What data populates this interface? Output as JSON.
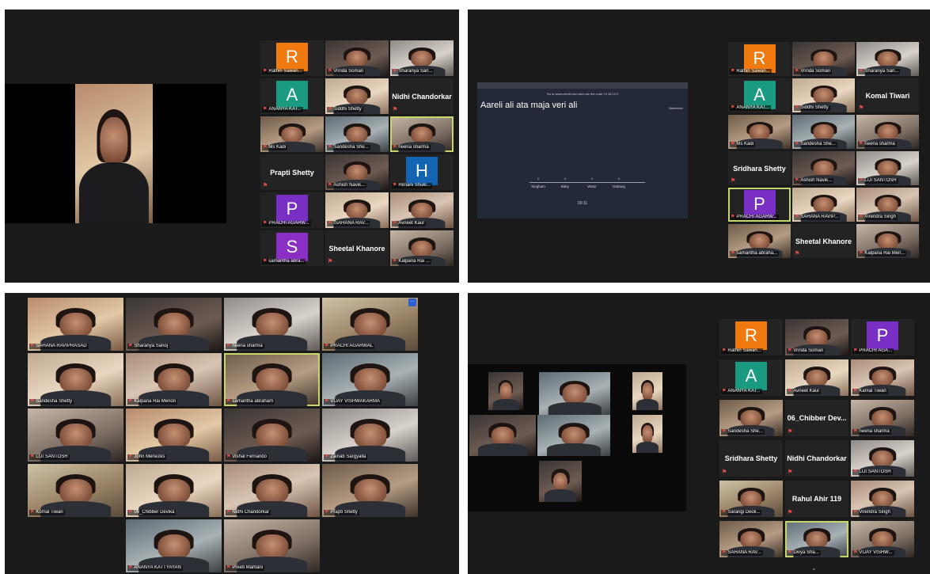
{
  "panel1": {
    "tiles": [
      {
        "label": "Rathin Sawan...",
        "avatar": "R",
        "color": "#f07a0f"
      },
      {
        "label": "Vrinda Soman"
      },
      {
        "label": "Sharanya San..."
      },
      {
        "label": "ANANYA KAT...",
        "avatar": "A",
        "color": "#1b9a82"
      },
      {
        "label": "Siddhi Shetty"
      },
      {
        "big": "Nidhi Chandorkar"
      },
      {
        "label": "Ms Kadi"
      },
      {
        "label": "Sandesha She..."
      },
      {
        "label": "neena sharma"
      },
      {
        "big": "Prapti Shetty"
      },
      {
        "label": "Ashish Navik..."
      },
      {
        "label": "Himani Shukl...",
        "avatar": "H",
        "color": "#1464b4"
      },
      {
        "label": "PRACHI AGARW...",
        "avatar": "P",
        "color": "#7a2fc4"
      },
      {
        "label": "ISAHANA RAV..."
      },
      {
        "label": "Avneet Kaur"
      },
      {
        "label": "samantha abra...",
        "avatar": "S",
        "color": "#8a2fc4"
      },
      {
        "big": "Sheetal Khanore"
      },
      {
        "label": "Kalpana Rai ..."
      }
    ]
  },
  "panel2": {
    "presentation": {
      "hint": "Go to www.menti.com and use the code 74 18 13 0",
      "brand": "Mentimeter",
      "title": "Aareli ali ata maja veri ali",
      "options": [
        "Singham",
        "Baby",
        "Wasir",
        "Dabang"
      ],
      "values": [
        "0",
        "0",
        "0",
        "0"
      ],
      "timer": "00:11"
    },
    "tiles": [
      {
        "label": "Rathin Sawan...",
        "avatar": "R",
        "color": "#f07a0f"
      },
      {
        "label": "Vrinda Soman"
      },
      {
        "label": "Sharanya San..."
      },
      {
        "label": "ANANYA KAT...",
        "avatar": "A",
        "color": "#1b9a82"
      },
      {
        "label": "Siddhi Shetty"
      },
      {
        "big": "Komal Tiwari"
      },
      {
        "label": "Ms Kadi"
      },
      {
        "label": "Sandesha She..."
      },
      {
        "label": "neena sharma"
      },
      {
        "big": "Sridhara Shetty"
      },
      {
        "label": "Ashish Navik..."
      },
      {
        "label": "LIJI SANTOSH"
      },
      {
        "label": "PRACHI AGARW...",
        "avatar": "P",
        "color": "#7a2fc4"
      },
      {
        "label": "SAHANA RAVIP..."
      },
      {
        "label": "Virendra Singh"
      },
      {
        "label": "samantha abraha..."
      },
      {
        "big": "Sheetal Khanore"
      },
      {
        "label": "Kalpana Rai Men..."
      }
    ]
  },
  "panel3": {
    "tiles": [
      {
        "label": "SAHANA RAVIPRASAD"
      },
      {
        "label": "Sharanya Sanoj"
      },
      {
        "label": "neena sharma"
      },
      {
        "label": "PRACHI AGARWAL"
      },
      {
        "label": "Sandesha Shetty"
      },
      {
        "label": "Kalpana Rai Menon"
      },
      {
        "label": "samantha abraham"
      },
      {
        "label": "VIJAY VISHWAKARMA"
      },
      {
        "label": "LIJI SANTOSH"
      },
      {
        "label": "John Menezes"
      },
      {
        "label": "Vishal Fernando"
      },
      {
        "label": "Zainab Sargyalla"
      },
      {
        "label": "Komal Tiwari"
      },
      {
        "label": "06_Chibber Devika"
      },
      {
        "label": "Nidhi Chandorkar"
      },
      {
        "label": "Prapti Shetty"
      },
      {
        "label": "ANANYA KATTYAYAN"
      },
      {
        "label": "Preeti Mahtani"
      }
    ]
  },
  "panel4": {
    "tiles": [
      {
        "label": "Rathin Sawan...",
        "avatar": "R",
        "color": "#f07a0f"
      },
      {
        "label": "Vrinda Soman"
      },
      {
        "label": "PRACHI AGA...",
        "avatar": "P",
        "color": "#7a2fc4"
      },
      {
        "label": "ANANYA KAT...",
        "avatar": "A",
        "color": "#1b9a82"
      },
      {
        "label": "Avneet Kaur"
      },
      {
        "label": "Kamal Tiwari"
      },
      {
        "label": "Sandesha She..."
      },
      {
        "big": "06_Chibber Dev..."
      },
      {
        "label": "neena sharma"
      },
      {
        "big": "Sridhara Shetty"
      },
      {
        "big": "Nidhi Chandorkar"
      },
      {
        "label": "LIJI SANTOSH"
      },
      {
        "label": "Sarangi Deoli..."
      },
      {
        "big": "Rahul Ahir 119"
      },
      {
        "label": "Virendra Singh"
      },
      {
        "label": "SAHANA RAV..."
      },
      {
        "label": "Divya Sha..."
      },
      {
        "label": "VIJAY VISHW..."
      }
    ]
  }
}
